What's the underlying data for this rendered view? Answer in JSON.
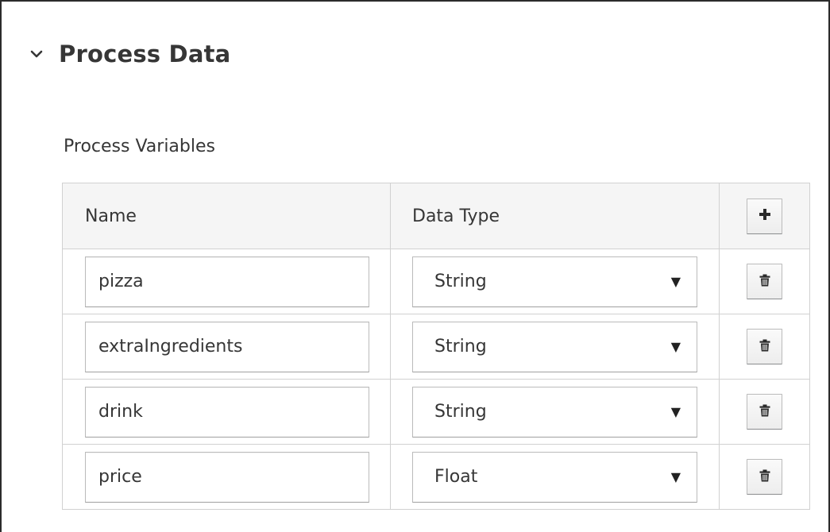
{
  "section": {
    "title": "Process Data",
    "chevron_icon": "chevron-down-icon"
  },
  "variables": {
    "label": "Process Variables",
    "headers": {
      "name": "Name",
      "data_type": "Data Type"
    },
    "add_icon": "plus-icon",
    "delete_icon": "trash-icon",
    "rows": [
      {
        "name": "pizza",
        "data_type": "String"
      },
      {
        "name": "extraIngredients",
        "data_type": "String"
      },
      {
        "name": "drink",
        "data_type": "String"
      },
      {
        "name": "price",
        "data_type": "Float"
      }
    ]
  }
}
